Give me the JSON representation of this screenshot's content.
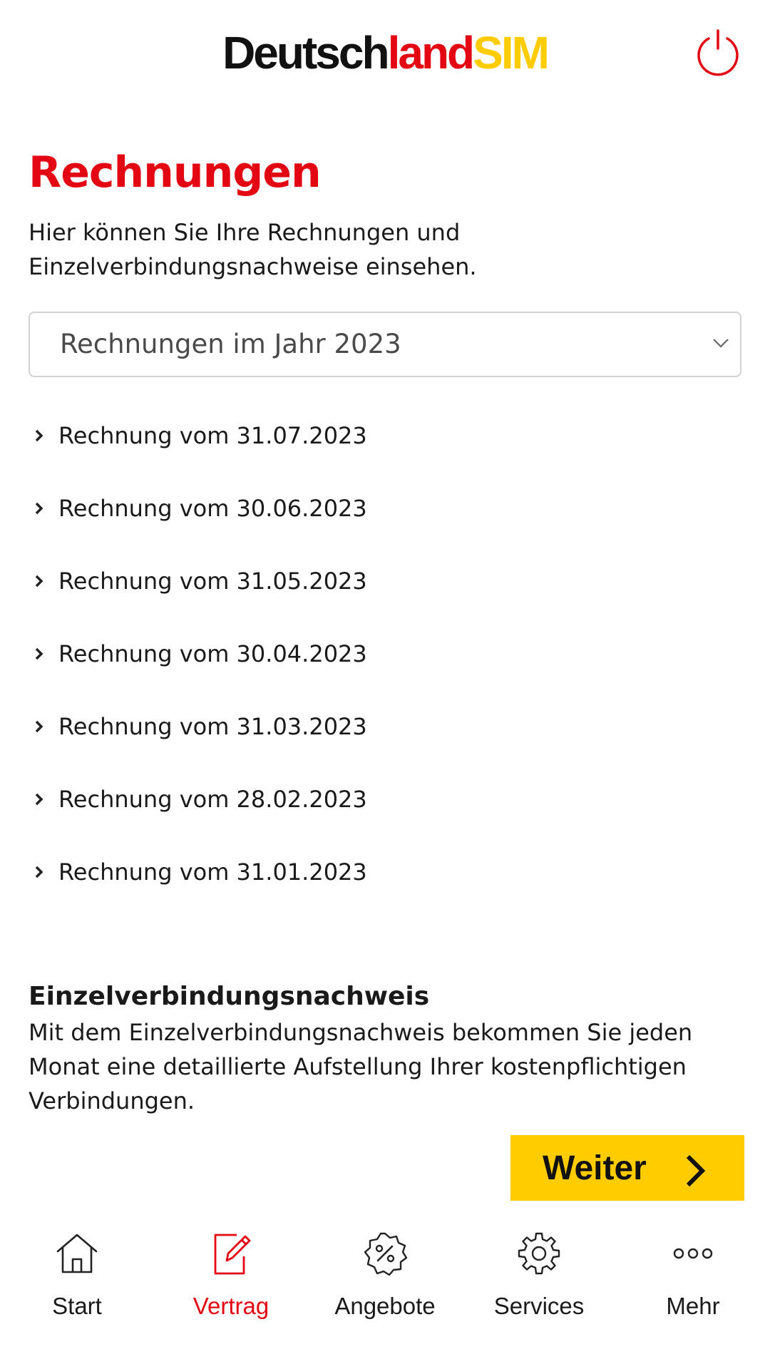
{
  "header": {
    "logo_part1": "Deutsch",
    "logo_part2": "land",
    "logo_part3": "SIM",
    "logout_icon": "power-icon"
  },
  "colors": {
    "brand_red": "#e30613",
    "brand_yellow": "#ffcc00",
    "text": "#1a1a1a"
  },
  "page": {
    "title": "Rechnungen",
    "intro": "Hier können Sie Ihre Rechnungen und Einzelverbindungsnachweise einsehen."
  },
  "year_select": {
    "value": "Rechnungen im Jahr 2023",
    "icon": "chevron-down-icon"
  },
  "invoices": [
    "Rechnung vom 31.07.2023",
    "Rechnung vom 30.06.2023",
    "Rechnung vom 31.05.2023",
    "Rechnung vom 30.04.2023",
    "Rechnung vom 31.03.2023",
    "Rechnung vom 28.02.2023",
    "Rechnung vom 31.01.2023"
  ],
  "evn": {
    "title": "Einzelverbindungsnachweis",
    "text": "Mit dem Einzelverbindungsnachweis bekommen Sie jeden Monat eine detaillierte Aufstellung Ihrer kostenpflichtigen Verbindungen.",
    "button_label": "Weiter"
  },
  "bottom_nav": {
    "active": "Vertrag",
    "items": [
      {
        "label": "Start",
        "icon": "home-icon"
      },
      {
        "label": "Vertrag",
        "icon": "contract-edit-icon"
      },
      {
        "label": "Angebote",
        "icon": "discount-badge-icon"
      },
      {
        "label": "Services",
        "icon": "gear-icon"
      },
      {
        "label": "Mehr",
        "icon": "more-dots-icon"
      }
    ]
  }
}
